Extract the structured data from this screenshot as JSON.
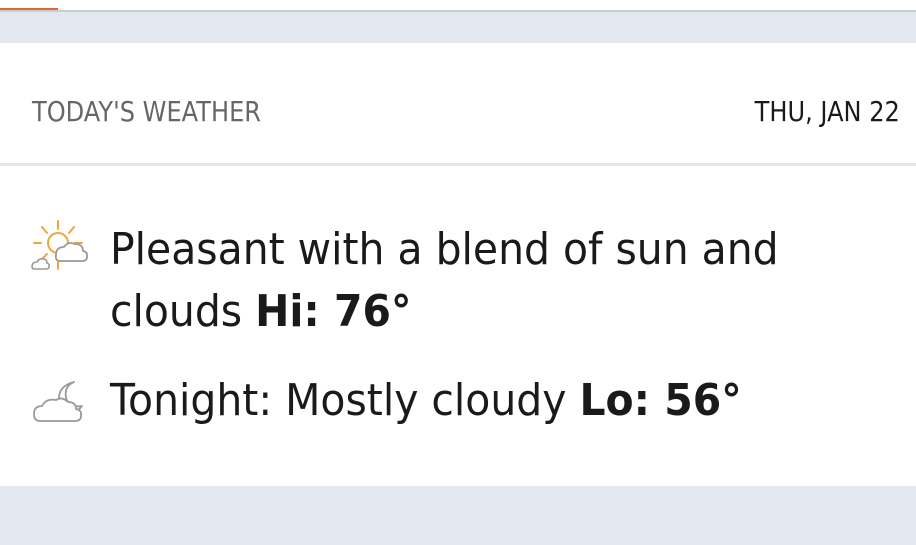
{
  "header": {
    "title": "TODAY'S WEATHER",
    "date": "THU, JAN 22"
  },
  "day": {
    "icon": "partly-sunny-icon",
    "description": "Pleasant with a blend of sun and clouds",
    "hi_label": "Hi: 76°"
  },
  "night": {
    "icon": "night-partly-cloudy-icon",
    "description": "Tonight: Mostly cloudy",
    "lo_label": "Lo: 56°"
  },
  "colors": {
    "accent": "#e0662b",
    "page_background": "#e3e8f0",
    "card_background": "#ffffff",
    "sun": "#f0a63a",
    "cloud_outline": "#9a9a9a"
  }
}
